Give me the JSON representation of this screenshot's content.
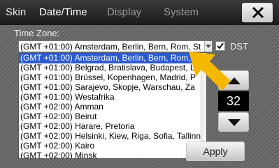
{
  "tabs": [
    {
      "label": "Skin"
    },
    {
      "label": "Date/Time"
    },
    {
      "label": "Display"
    },
    {
      "label": "System"
    }
  ],
  "active_tab": "Date/Time",
  "close_icon": "close-x-icon",
  "time_zone": {
    "label": "Time Zone:",
    "selected_value": "(GMT +01:00) Amsterdam, Berlin, Bern, Rom, St",
    "options": [
      "(GMT +01:00) Amsterdam, Berlin, Bern, Rom, St",
      "(GMT +01:00) Belgrad, Bratislava, Budapest, L",
      "(GMT +01:00) Brüssel, Kopenhagen, Madrid, P",
      "(GMT +01:00) Sarajevo, Skopje, Warschau, Za",
      "(GMT +01:00) Westafrika",
      "(GMT +02:00) Amman",
      "(GMT +02:00) Beirut",
      "(GMT +02:00) Harare, Pretoria",
      "(GMT +02:00) Helsinki, Kiew, Riga, Sofia, Tallinn",
      "(GMT +02:00) Kairo",
      "(GMT +02:00) Minsk"
    ]
  },
  "dst": {
    "label": "DST",
    "checked": true
  },
  "stepper": {
    "value": "32"
  },
  "apply_label": "Apply",
  "colors": {
    "selection": "#2c5bd1",
    "pointer": "#f5b800"
  }
}
